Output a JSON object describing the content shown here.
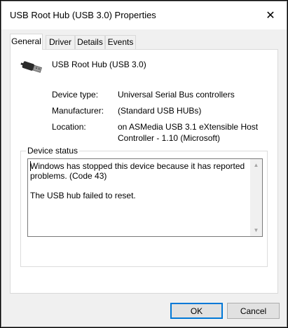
{
  "window": {
    "title": "USB Root Hub (USB 3.0) Properties",
    "close_glyph": "✕"
  },
  "tabs": [
    {
      "label": "General",
      "active": true
    },
    {
      "label": "Driver",
      "active": false
    },
    {
      "label": "Details",
      "active": false
    },
    {
      "label": "Events",
      "active": false
    }
  ],
  "device": {
    "icon": "usb-connector-icon",
    "name": "USB Root Hub (USB 3.0)"
  },
  "properties": [
    {
      "label": "Device type:",
      "value": "Universal Serial Bus controllers"
    },
    {
      "label": "Manufacturer:",
      "value": "(Standard USB HUBs)"
    },
    {
      "label": "Location:",
      "value": "on ASMedia USB 3.1 eXtensible Host\nController - 1.10 (Microsoft)"
    }
  ],
  "status": {
    "legend": "Device status",
    "text": "Windows has stopped this device because it has reported\nproblems. (Code 43)\n\nThe USB hub failed to reset."
  },
  "buttons": {
    "ok": "OK",
    "cancel": "Cancel"
  },
  "colors": {
    "accent": "#0078d7",
    "panel_bg": "#ffffff",
    "window_bg": "#f0f0f0"
  }
}
